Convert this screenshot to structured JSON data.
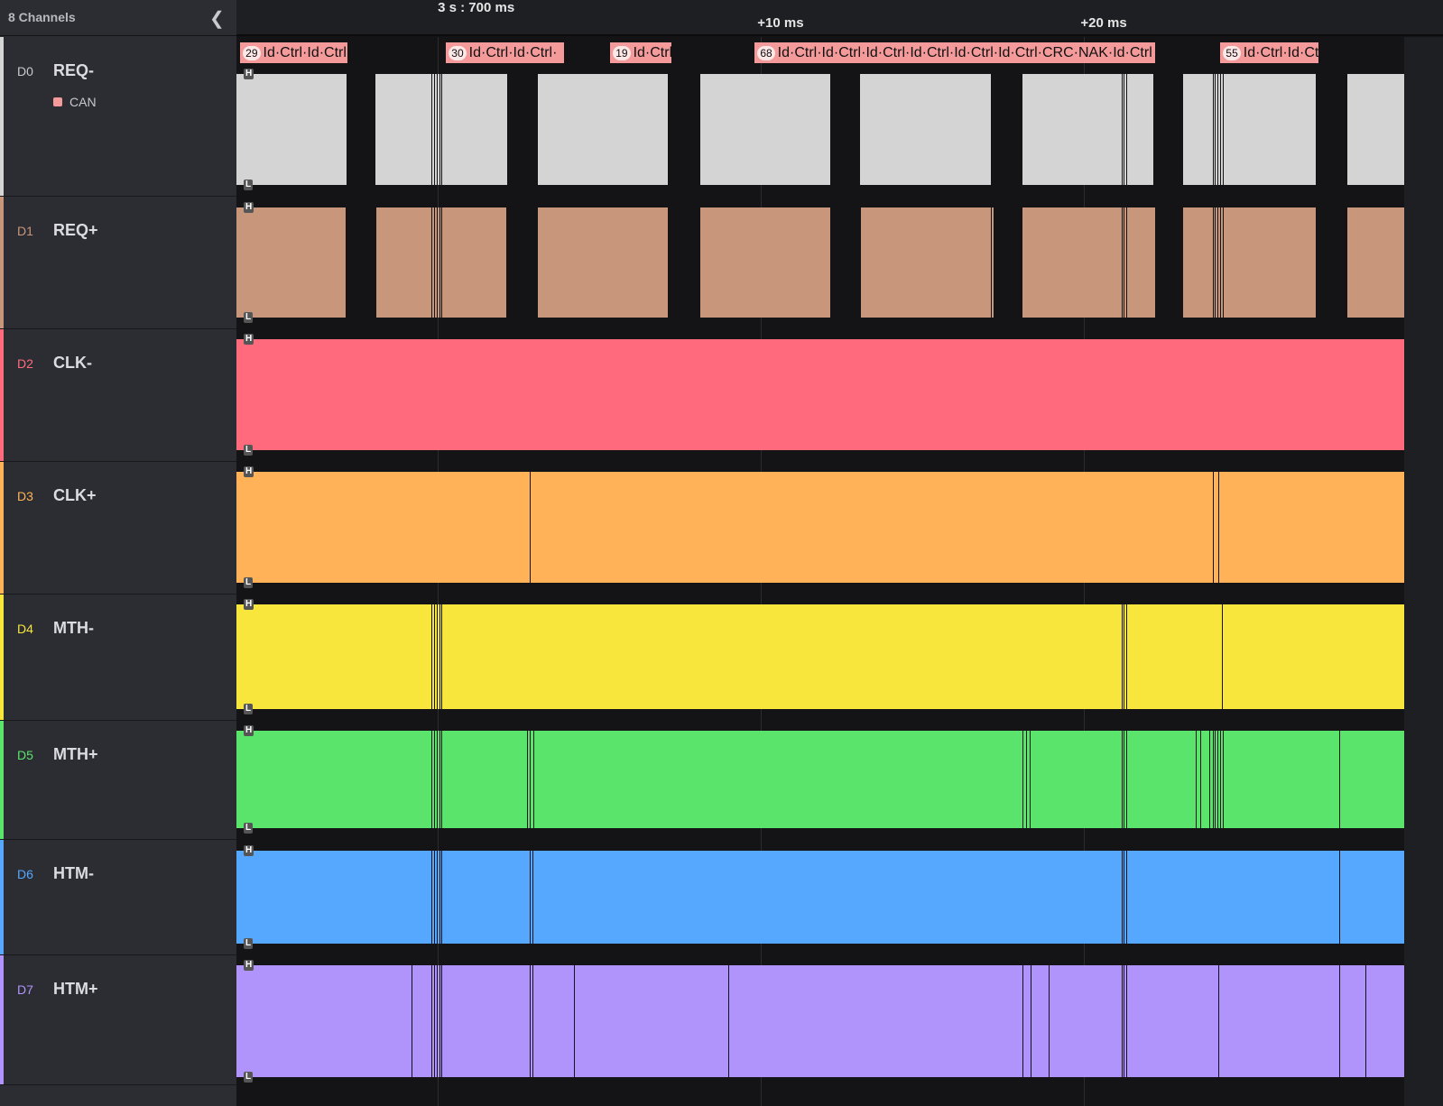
{
  "sidebar": {
    "title": "8 Channels",
    "collapse_icon": "chevron-left-icon",
    "analyzer": "CAN"
  },
  "timeline": {
    "ticks": [
      {
        "label": "3 s : 700 ms",
        "t": 0
      },
      {
        "label": "+10 ms",
        "t": 10
      },
      {
        "label": "+20 ms",
        "t": 20
      }
    ],
    "view_start_ms": -6.23,
    "view_end_ms": 29.9
  },
  "channels": [
    {
      "id": "D0",
      "name": "REQ-",
      "color": "#d4d4d4",
      "lows": [
        [
          -2.82,
          -1.93
        ],
        [
          2.15,
          3.1
        ],
        [
          7.12,
          8.13
        ],
        [
          12.15,
          13.07
        ],
        [
          17.12,
          18.1
        ],
        [
          22.15,
          23.07
        ],
        [
          27.15,
          28.13
        ]
      ],
      "glitches": [
        -2.6,
        -2.45,
        -2.25,
        -0.2,
        -0.12,
        -0.04,
        0.04,
        0.12,
        7.3,
        12.4,
        12.6,
        17.95,
        21.15,
        21.22,
        21.29,
        22.5,
        22.85,
        22.95,
        23.97,
        24.05,
        24.13,
        24.21,
        24.3,
        27.4,
        27.6,
        27.9
      ]
    },
    {
      "id": "D1",
      "name": "REQ+",
      "color": "#c8967a",
      "lows": [
        [
          -2.85,
          -1.9
        ],
        [
          2.12,
          3.1
        ],
        [
          7.12,
          8.13
        ],
        [
          12.15,
          13.1
        ],
        [
          17.2,
          18.1
        ],
        [
          22.18,
          23.07
        ],
        [
          27.15,
          28.13
        ]
      ],
      "glitches": [
        -0.2,
        -0.12,
        -0.04,
        0.04,
        0.12,
        17.1,
        21.15,
        21.22,
        21.29,
        23.97,
        24.05,
        24.13,
        24.21,
        24.3
      ]
    },
    {
      "id": "D2",
      "name": "CLK-",
      "color": "#ff6b7d",
      "lows": [],
      "glitches": []
    },
    {
      "id": "D3",
      "name": "CLK+",
      "color": "#ffb257",
      "lows": [],
      "glitches": [
        2.85,
        23.97,
        24.16
      ]
    },
    {
      "id": "D4",
      "name": "MTH-",
      "color": "#f8e63d",
      "lows": [],
      "glitches": [
        -0.2,
        -0.12,
        -0.04,
        0.04,
        0.12,
        21.15,
        21.22,
        21.29,
        24.25
      ]
    },
    {
      "id": "D5",
      "name": "MTH+",
      "color": "#5be46c",
      "lows": [],
      "glitches": [
        -0.2,
        -0.12,
        -0.04,
        0.04,
        0.12,
        2.75,
        2.85,
        2.95,
        18.1,
        18.2,
        18.3,
        21.15,
        21.22,
        21.29,
        23.45,
        23.6,
        23.88,
        23.97,
        24.05,
        24.13,
        24.21,
        24.3,
        27.9
      ]
    },
    {
      "id": "D6",
      "name": "HTM-",
      "color": "#55a8fd",
      "lows": [],
      "glitches": [
        -0.2,
        -0.12,
        -0.04,
        0.04,
        0.12,
        2.85,
        2.92,
        21.15,
        21.22,
        21.29,
        27.9
      ]
    },
    {
      "id": "D7",
      "name": "HTM+",
      "color": "#b094fb",
      "lows": [],
      "glitches": [
        -0.8,
        -0.2,
        -0.12,
        -0.04,
        0.04,
        0.12,
        2.85,
        2.92,
        4.2,
        9.0,
        18.1,
        18.35,
        18.9,
        21.15,
        21.22,
        21.29,
        24.16,
        27.9,
        28.7
      ]
    }
  ],
  "can_frames": [
    {
      "n": "29",
      "text": "Id·Ctrl·Id·Ctrl",
      "t0": -6.17,
      "t1": -2.85
    },
    {
      "n": "30",
      "text": "Id·Ctrl·Id·Ctrl·",
      "t0": 0.2,
      "t1": 3.85
    },
    {
      "n": "19",
      "text": "Id·Ctrl",
      "t0": 5.28,
      "t1": 7.18
    },
    {
      "n": "68",
      "text": "Id·Ctrl·Id·Ctrl·Id·Ctrl·Id·Ctrl·Id·Ctrl·Id·Ctrl·CRC·NAK·Id·Ctrl",
      "t0": 9.75,
      "t1": 22.15
    },
    {
      "n": "55",
      "text": "Id·Ctrl·Id·Ctrl",
      "t0": 24.16,
      "t1": 27.18
    }
  ],
  "level_labels": {
    "high": "H",
    "low": "L"
  }
}
